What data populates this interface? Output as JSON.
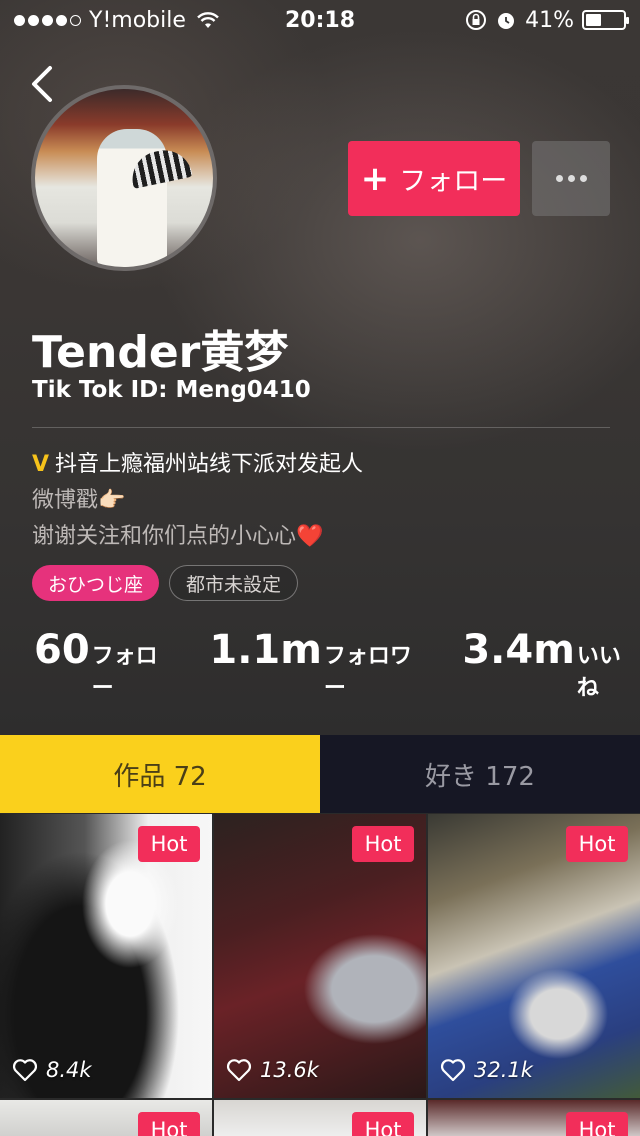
{
  "status_bar": {
    "carrier": "Y!mobile",
    "time": "20:18",
    "battery": "41%",
    "battery_level": 0.41,
    "signal_bars_filled": 4,
    "signal_bars_total": 5
  },
  "header": {
    "follow_label": "フォロー"
  },
  "profile": {
    "name": "Tender黄梦",
    "tiktok_id": "Tik Tok ID: Meng0410",
    "bio_line1": "抖音上瘾福州站线下派对发起人",
    "bio_line2": "微博戳👉🏻",
    "bio_line3": "谢谢关注和你们点的小心心",
    "bio_heart": "❤️",
    "verified_mark": "V",
    "tags": [
      "おひつじ座",
      "都市未設定"
    ]
  },
  "stats": [
    {
      "value": "60",
      "label": "フォロー"
    },
    {
      "value": "1.1m",
      "label": "フォロワー"
    },
    {
      "value": "3.4m",
      "label": "いいね"
    }
  ],
  "tabs": [
    {
      "label": "作品 72",
      "active": true
    },
    {
      "label": "好き 172",
      "active": false
    }
  ],
  "videos": [
    {
      "badge": "Hot",
      "likes": "8.4k"
    },
    {
      "badge": "Hot",
      "likes": "13.6k"
    },
    {
      "badge": "Hot",
      "likes": "32.1k"
    },
    {
      "badge": "Hot",
      "likes": ""
    },
    {
      "badge": "Hot",
      "likes": ""
    },
    {
      "badge": "Hot",
      "likes": ""
    }
  ],
  "colors": {
    "accent": "#f22e5a",
    "tab_active": "#fad01c",
    "tab_inactive": "#161724",
    "tag_pink": "#e6327c",
    "verified": "#f6c31b"
  }
}
